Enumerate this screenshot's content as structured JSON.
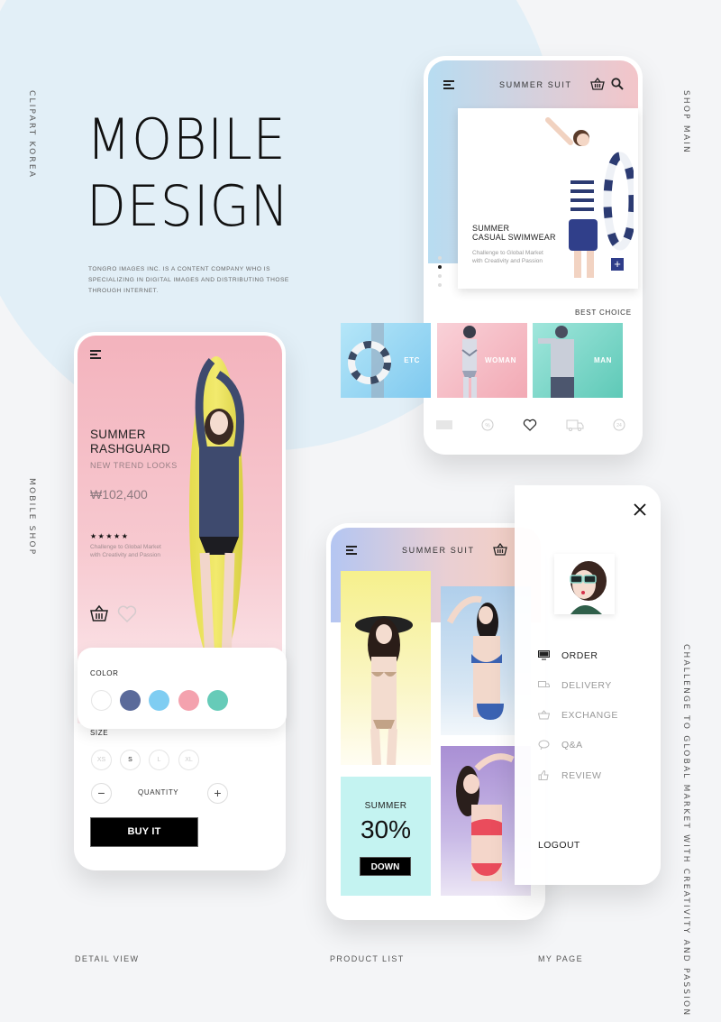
{
  "page": {
    "title_line1": "MOBILE",
    "title_line2": "DESIGN",
    "description": "TONGRO IMAGES INC. IS A CONTENT COMPANY WHO IS SPECIALIZING IN DIGITAL IMAGES AND DISTRIBUTING THOSE THROUGH INTERNET.",
    "side_labels": {
      "left_top": "CLIPART KOREA",
      "left_mid": "MOBILE SHOP",
      "right_top": "SHOP MAIN",
      "right_bottom": "CHALLENGE TO GLOBAL MARKET WITH CREATIVITY AND PASSION"
    },
    "captions": [
      "DETAIL VIEW",
      "PRODUCT LIST",
      "MY PAGE"
    ]
  },
  "shop_main": {
    "app_title": "SUMMER SUIT",
    "menu_icon": "hamburger-icon",
    "cart_icon": "basket-icon",
    "search_icon": "search-icon",
    "banner": {
      "title_line1": "SUMMER",
      "title_line2": "CASUAL SWIMWEAR",
      "subtitle": "Challenge to Global Market with Creativity and Passion",
      "plus_icon": "plus-icon"
    },
    "carousel": {
      "count": 4,
      "active_index": 1
    },
    "section_title": "BEST CHOICE",
    "categories": [
      {
        "label": "ETC",
        "color": "#8ad3f2"
      },
      {
        "label": "WOMAN",
        "color": "#f4aeb8"
      },
      {
        "label": "MAN",
        "color": "#6ccfc0"
      }
    ],
    "tabbar": [
      {
        "icon": "barcode-icon",
        "active": false
      },
      {
        "icon": "percent-icon",
        "active": false
      },
      {
        "icon": "heart-icon",
        "active": true
      },
      {
        "icon": "truck-icon",
        "active": false
      },
      {
        "icon": "24h-support-icon",
        "active": false
      }
    ]
  },
  "detail": {
    "menu_icon": "hamburger-icon",
    "title_line1": "SUMMER",
    "title_line2": "RASHGUARD",
    "subtitle": "NEW TREND LOOKS",
    "price": "₩102,400",
    "rating": 5,
    "stars": "★★★★★",
    "description": "Challenge to Global Market with Creativity and Passion",
    "color_label": "COLOR",
    "colors": [
      "#ffffff",
      "#5a6a9a",
      "#7fcdf2",
      "#f4a2ae",
      "#66cbb8"
    ],
    "size_label": "SIZE",
    "sizes": [
      "XS",
      "S",
      "L",
      "XL"
    ],
    "selected_size": "S",
    "quantity_label": "QUANTITY",
    "minus": "−",
    "plus": "+",
    "buy_label": "BUY IT"
  },
  "product_list": {
    "app_title": "SUMMER SUIT",
    "promo": {
      "line1": "SUMMER",
      "value": "30%",
      "button": "DOWN"
    }
  },
  "my_page": {
    "close_icon": "close-icon",
    "menu": [
      {
        "label": "ORDER",
        "icon": "monitor-icon",
        "active": true
      },
      {
        "label": "DELIVERY",
        "icon": "truck-icon",
        "active": false
      },
      {
        "label": "EXCHANGE",
        "icon": "basket-icon",
        "active": false
      },
      {
        "label": "Q&A",
        "icon": "chat-icon",
        "active": false
      },
      {
        "label": "REVIEW",
        "icon": "thumbs-up-icon",
        "active": false
      }
    ],
    "logout": "LOGOUT"
  }
}
